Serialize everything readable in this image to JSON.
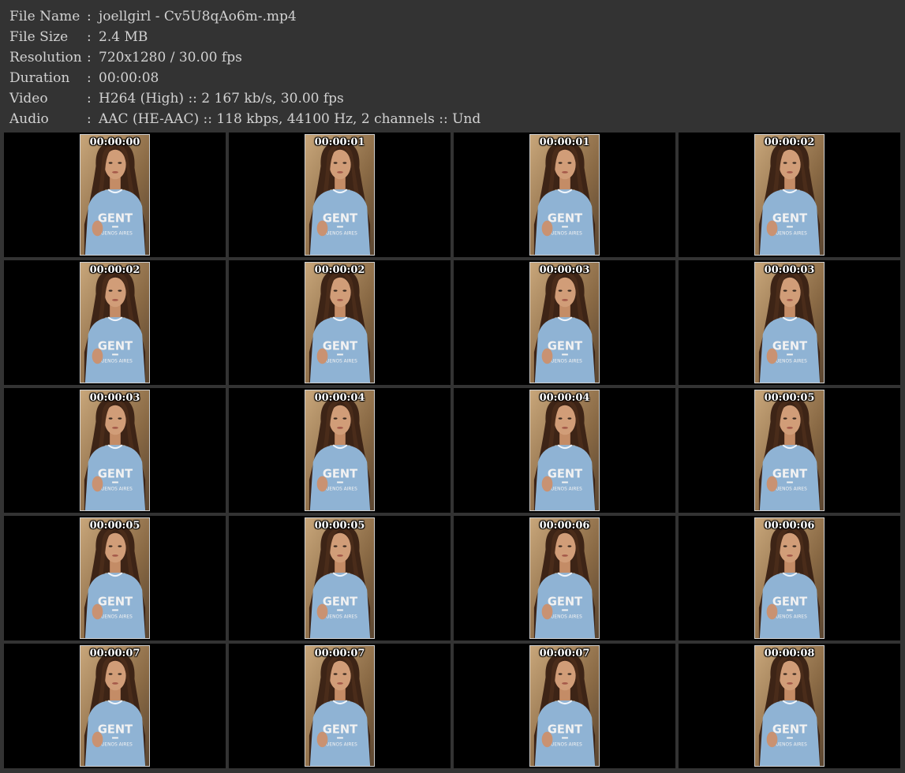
{
  "info": [
    {
      "label": "File Name",
      "sep": ":",
      "value": "joellgirl - Cv5U8qAo6m-.mp4"
    },
    {
      "label": "File Size",
      "sep": ":",
      "value": "2.4 MB"
    },
    {
      "label": "Resolution",
      "sep": ":",
      "value": "720x1280 / 30.00 fps"
    },
    {
      "label": "Duration",
      "sep": ":",
      "value": "00:00:08"
    },
    {
      "label": "Video",
      "sep": ":",
      "value": "H264 (High) :: 2 167 kb/s, 30.00 fps"
    },
    {
      "label": "Audio",
      "sep": ":",
      "value": "AAC (HE-AAC) :: 118 kbps, 44100 Hz, 2 channels :: Und"
    }
  ],
  "shirt_text": {
    "main": "GENT",
    "sub": "BUENOS AIRES"
  },
  "colors": {
    "page_bg": "#333333",
    "cell_bg": "#000000",
    "info_text": "#d2d2d2",
    "timestamp_text": "#ffffff"
  },
  "thumbnails": [
    {
      "timestamp": "00:00:00",
      "icon": "video-frame"
    },
    {
      "timestamp": "00:00:01",
      "icon": "video-frame"
    },
    {
      "timestamp": "00:00:01",
      "icon": "video-frame"
    },
    {
      "timestamp": "00:00:02",
      "icon": "video-frame"
    },
    {
      "timestamp": "00:00:02",
      "icon": "video-frame"
    },
    {
      "timestamp": "00:00:02",
      "icon": "video-frame"
    },
    {
      "timestamp": "00:00:03",
      "icon": "video-frame"
    },
    {
      "timestamp": "00:00:03",
      "icon": "video-frame"
    },
    {
      "timestamp": "00:00:03",
      "icon": "video-frame"
    },
    {
      "timestamp": "00:00:04",
      "icon": "video-frame"
    },
    {
      "timestamp": "00:00:04",
      "icon": "video-frame"
    },
    {
      "timestamp": "00:00:05",
      "icon": "video-frame"
    },
    {
      "timestamp": "00:00:05",
      "icon": "video-frame"
    },
    {
      "timestamp": "00:00:05",
      "icon": "video-frame"
    },
    {
      "timestamp": "00:00:06",
      "icon": "video-frame"
    },
    {
      "timestamp": "00:00:06",
      "icon": "video-frame"
    },
    {
      "timestamp": "00:00:07",
      "icon": "video-frame"
    },
    {
      "timestamp": "00:00:07",
      "icon": "video-frame"
    },
    {
      "timestamp": "00:00:07",
      "icon": "video-frame"
    },
    {
      "timestamp": "00:00:08",
      "icon": "video-frame"
    }
  ]
}
